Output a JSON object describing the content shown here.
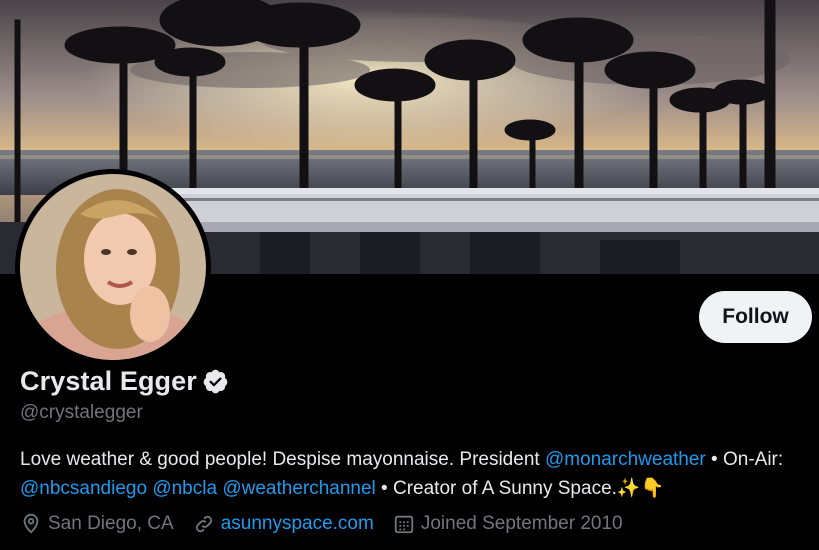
{
  "profile": {
    "display_name": "Crystal Egger",
    "handle": "@crystalegger",
    "verified_icon": "verified-badge-icon",
    "follow_label": "Follow"
  },
  "bio": {
    "part1": "Love weather & good people! Despise mayonnaise. President ",
    "mention1": "@monarchweather",
    "part2": " • On-Air: ",
    "mention2": "@nbcsandiego",
    "part3": " ",
    "mention3": "@nbcla",
    "part4": " ",
    "mention4": "@weatherchannel",
    "part5": " • Creator of A Sunny Space.",
    "emoji1": "✨",
    "emoji2": "👇"
  },
  "meta": {
    "location_icon": "location-pin-icon",
    "location": "San Diego, CA",
    "link_icon": "link-icon",
    "website": "asunnyspace.com",
    "calendar_icon": "calendar-icon",
    "joined": "Joined September 2010"
  },
  "colors": {
    "background": "#000000",
    "text_primary": "#e7e9ea",
    "text_secondary": "#71767b",
    "link": "#1d9bf0",
    "button_bg": "#eff3f4"
  }
}
